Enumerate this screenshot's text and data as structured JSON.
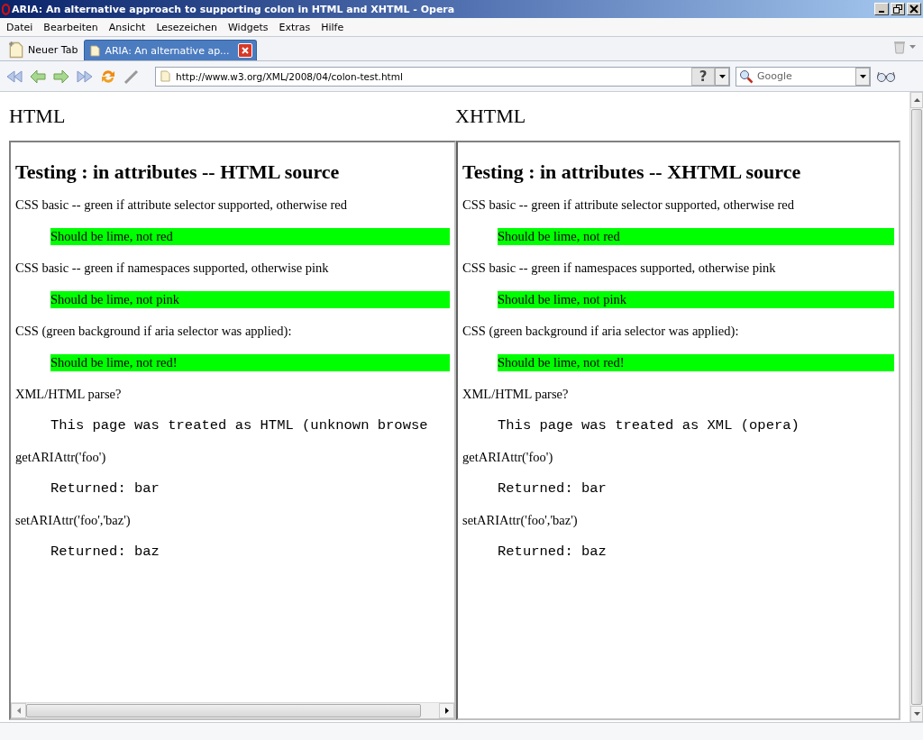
{
  "window": {
    "title": "ARIA: An alternative approach to supporting colon in HTML and XHTML - Opera"
  },
  "menu": [
    "Datei",
    "Bearbeiten",
    "Ansicht",
    "Lesezeichen",
    "Widgets",
    "Extras",
    "Hilfe"
  ],
  "tabs": [
    {
      "label": "Neuer Tab",
      "kind": "new",
      "selected": false
    },
    {
      "label": "ARIA: An alternative ap...",
      "kind": "page",
      "selected": true
    }
  ],
  "address": {
    "value": "http://www.w3.org/XML/2008/04/colon-test.html",
    "help_label": "?"
  },
  "search": {
    "placeholder": "Google"
  },
  "page_headings": [
    "HTML",
    "XHTML"
  ],
  "frames": [
    {
      "heading": "Testing : in attributes -- HTML source",
      "scrollbar": true,
      "items": [
        {
          "kind": "text",
          "text": "CSS basic -- green if attribute selector supported, otherwise red"
        },
        {
          "kind": "box",
          "text": "Should be lime, not red"
        },
        {
          "kind": "text",
          "text": "CSS basic -- green if namespaces supported, otherwise pink"
        },
        {
          "kind": "box",
          "text": "Should be lime, not pink"
        },
        {
          "kind": "text",
          "text": "CSS (green background if aria selector was applied):"
        },
        {
          "kind": "box",
          "text": "Should be lime, not red!"
        },
        {
          "kind": "text",
          "text": "XML/HTML parse?"
        },
        {
          "kind": "code",
          "text": "This page was treated as HTML (unknown browse"
        },
        {
          "kind": "text",
          "text": "getARIAttr('foo')"
        },
        {
          "kind": "code",
          "text": "Returned: bar"
        },
        {
          "kind": "text",
          "text": "setARIAttr('foo','baz')"
        },
        {
          "kind": "code",
          "text": "Returned: baz"
        }
      ]
    },
    {
      "heading": "Testing : in attributes -- XHTML source",
      "scrollbar": false,
      "items": [
        {
          "kind": "text",
          "text": "CSS basic -- green if attribute selector supported, otherwise red"
        },
        {
          "kind": "box",
          "text": "Should be lime, not red"
        },
        {
          "kind": "text",
          "text": "CSS basic -- green if namespaces supported, otherwise pink"
        },
        {
          "kind": "box",
          "text": "Should be lime, not pink"
        },
        {
          "kind": "text",
          "text": "CSS (green background if aria selector was applied):"
        },
        {
          "kind": "box",
          "text": "Should be lime, not red!"
        },
        {
          "kind": "text",
          "text": "XML/HTML parse?"
        },
        {
          "kind": "code",
          "text": "This page was treated as XML (opera)"
        },
        {
          "kind": "text",
          "text": "getARIAttr('foo')"
        },
        {
          "kind": "code",
          "text": "Returned: bar"
        },
        {
          "kind": "text",
          "text": "setARIAttr('foo','baz')"
        },
        {
          "kind": "code",
          "text": "Returned: baz"
        }
      ]
    }
  ]
}
